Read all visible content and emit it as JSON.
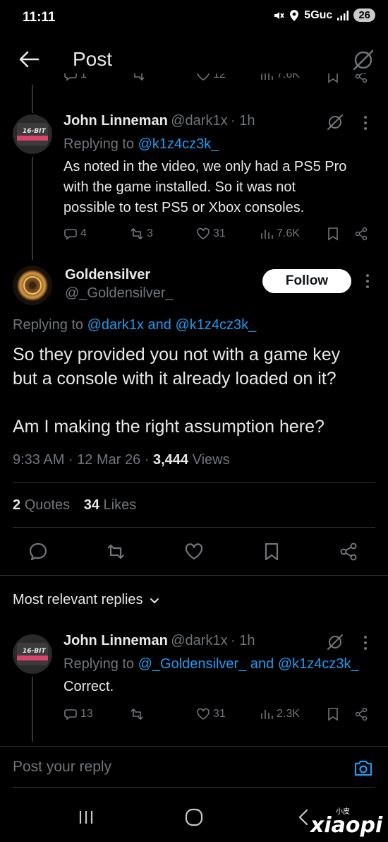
{
  "status_bar": {
    "time": "11:11",
    "network": "5Guc",
    "battery": "26"
  },
  "header": {
    "title": "Post"
  },
  "top_partial_stats": {
    "replies": "1",
    "likes": "12",
    "views": "7.6K"
  },
  "reply1": {
    "name": "John Linneman",
    "handle": "@dark1x",
    "time": "· 1h",
    "replying_label": "Replying to",
    "replying_to": "@k1z4cz3k_",
    "text_lines": [
      "As noted in the video, we only had a PS5 Pro",
      "with the game installed. So it was not",
      "possible to test PS5 or Xbox consoles."
    ],
    "replies": "4",
    "reposts": "3",
    "likes": "31",
    "views": "7.6K"
  },
  "main_post": {
    "name": "Goldensilver",
    "handle": "@_Goldensilver_",
    "follow_label": "Follow",
    "replying_label": "Replying to",
    "replying_to": "@dark1x and @k1z4cz3k_",
    "text_line1": "So they provided you not with a game key",
    "text_line2": "but a console with it already loaded on it?",
    "text_line3": "Am I making the right assumption here?",
    "meta_time": "9:33 AM · 12 Mar 26 · ",
    "views_count": "3,444",
    "views_label": " Views",
    "quotes_count": "2",
    "quotes_label": "Quotes",
    "likes_count": "34",
    "likes_label": "Likes"
  },
  "sort": {
    "label": "Most relevant replies"
  },
  "reply2": {
    "name": "John Linneman",
    "handle": "@dark1x",
    "time": "· 1h",
    "replying_label": "Replying to",
    "replying_to": "@_Goldensilver_ and @k1z4cz3k_",
    "text": "Correct.",
    "replies": "13",
    "likes": "31",
    "views": "2.3K"
  },
  "composer": {
    "placeholder": "Post your reply"
  },
  "avatar_badge_text": "16-BIT",
  "watermark": "xiaopi 小皮",
  "colors": {
    "background": "#000000",
    "text": "#e7e9ea",
    "muted": "#71767b",
    "link": "#1d9bf0"
  }
}
